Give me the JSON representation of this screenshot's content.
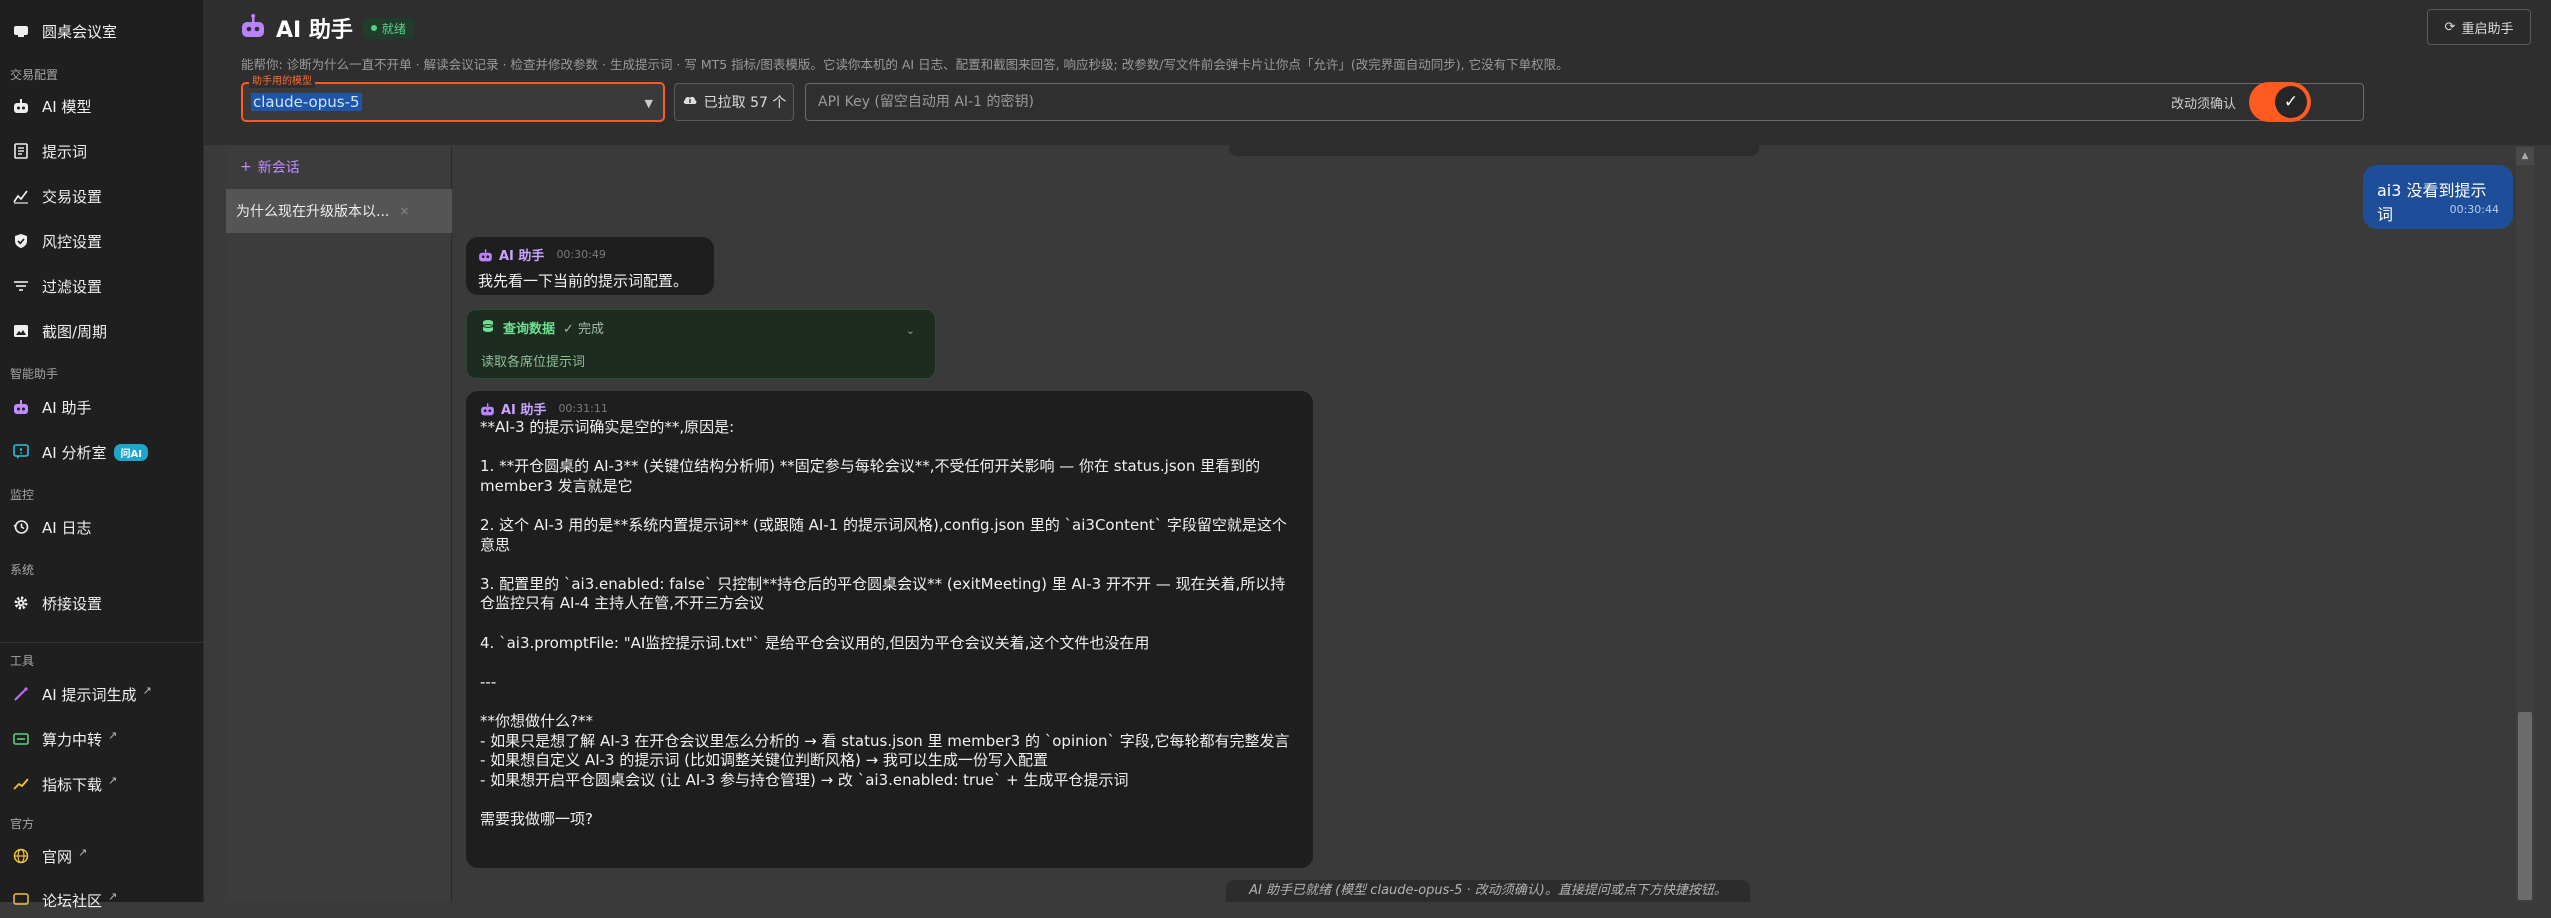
{
  "sidebar": {
    "sections": {
      "trade": "交易配置",
      "smart": "智能助手",
      "monitor": "监控",
      "system": "系统",
      "tools": "工具",
      "official": "官方"
    },
    "items": {
      "roundtable": "圆桌会议室",
      "ai_model": "AI 模型",
      "prompt": "提示词",
      "trade_settings": "交易设置",
      "risk": "风控设置",
      "filter": "过滤设置",
      "screenshot": "截图/周期",
      "ai_assistant": "AI 助手",
      "ai_analysis": "AI 分析室",
      "ai_analysis_badge": "问AI",
      "ai_log": "AI 日志",
      "bridge": "桥接设置",
      "prompt_gen": "AI 提示词生成",
      "compute": "算力中转",
      "indicator": "指标下载",
      "website": "官网",
      "forum": "论坛社区"
    }
  },
  "header": {
    "title": "AI 助手",
    "status": "就绪",
    "restart": "重启助手",
    "description": "能帮你: 诊断为什么一直不开单 · 解读会议记录 · 检查并修改参数 · 生成提示词 · 写 MT5 指标/图表模版。它读你本机的 AI 日志、配置和截图来回答, 响应秒级; 改参数/写文件前会弹卡片让你点「允许」(改完界面自动同步), 它没有下单权限。",
    "model_legend": "助手用的模型",
    "model_value": "claude-opus-5",
    "pulled": "已拉取 57 个",
    "apikey_placeholder": "API Key (留空自动用 AI-1 的密钥)",
    "confirm_label": "改动须确认",
    "confirm_on": true
  },
  "conversations": {
    "new": "新会话",
    "items": [
      "为什么现在升级版本以..."
    ]
  },
  "chat": {
    "user_msg": "ai3 没看到提示词",
    "user_time": "00:30:44",
    "ai_name": "AI 助手",
    "msg1_time": "00:30:49",
    "msg1_text": "我先看一下当前的提示词配置。",
    "tool_name": "查询数据",
    "tool_status": "✓ 完成",
    "tool_desc": "读取各席位提示词",
    "msg2_time": "00:31:11",
    "msg2_lines": [
      "**AI-3 的提示词确实是空的**,原因是:",
      "",
      "1. **开仓圆桌的 AI-3** (关键位结构分析师) **固定参与每轮会议**,不受任何开关影响 — 你在 status.json 里看到的 member3 发言就是它",
      "",
      "2. 这个 AI-3 用的是**系统内置提示词** (或跟随 AI-1 的提示词风格),config.json 里的 `ai3Content` 字段留空就是这个意思",
      "",
      "3. 配置里的 `ai3.enabled: false` 只控制**持仓后的平仓圆桌会议** (exitMeeting) 里 AI-3 开不开 — 现在关着,所以持仓监控只有 AI-4 主持人在管,不开三方会议",
      "",
      "4. `ai3.promptFile: \"AI监控提示词.txt\"` 是给平仓会议用的,但因为平仓会议关着,这个文件也没在用",
      "",
      "---",
      "",
      "**你想做什么?**",
      "- 如果只是想了解 AI-3 在开仓会议里怎么分析的 → 看 status.json 里 member3 的 `opinion` 字段,它每轮都有完整发言",
      "- 如果想自定义 AI-3 的提示词 (比如调整关键位判断风格) → 我可以生成一份写入配置",
      "- 如果想开启平仓圆桌会议 (让 AI-3 参与持仓管理) → 改 `ai3.enabled: true` + 生成平仓提示词",
      "",
      "需要我做哪一项?"
    ],
    "footer": "AI 助手已就绪 (模型 claude-opus-5 · 改动须确认)。直接提问或点下方快捷按钮。"
  },
  "colors": {
    "accent": "#ff5a1f",
    "user_bubble": "#1e4e9a",
    "ai_bubble": "#1e1e1e",
    "brand_purple": "#c08cff"
  }
}
